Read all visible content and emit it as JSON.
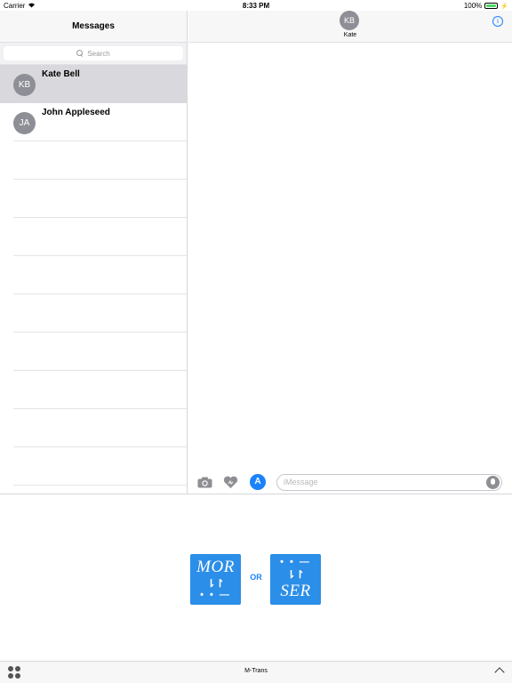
{
  "status_bar": {
    "carrier": "Carrier",
    "time": "8:33 PM",
    "battery": "100%"
  },
  "sidebar": {
    "title": "Messages",
    "search_placeholder": "Search",
    "conversations": [
      {
        "initials": "KB",
        "name": "Kate Bell",
        "selected": true
      },
      {
        "initials": "JA",
        "name": "John Appleseed",
        "selected": false
      }
    ]
  },
  "conversation": {
    "contact_initials": "KB",
    "contact_name": "Kate"
  },
  "compose": {
    "placeholder": "iMessage"
  },
  "drawer": {
    "sticker_1": {
      "word": "MOR",
      "arrow": "⇂↾",
      "code": "• • —"
    },
    "or_label": "OR",
    "sticker_2": {
      "code": "• • —",
      "arrow": "⇂↾",
      "word": "SER"
    }
  },
  "bottom_bar": {
    "app_name": "M-Trans"
  },
  "colors": {
    "accent": "#1a82fb",
    "sticker_bg": "#2b8ee8",
    "selected_row": "#d9d9dd"
  }
}
